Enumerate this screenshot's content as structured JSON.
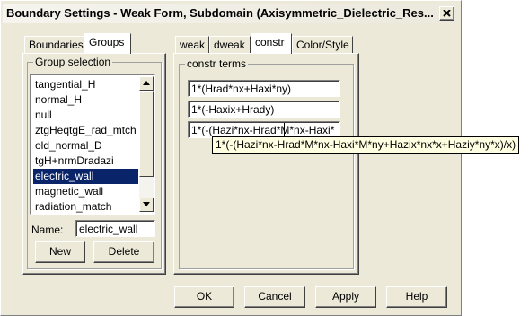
{
  "window": {
    "title": "Boundary Settings - Weak Form, Subdomain (Axisymmetric_Dielectric_Res..."
  },
  "left_tabs": [
    "Boundaries",
    "Groups"
  ],
  "group_selection": {
    "label": "Group selection",
    "items": [
      "tangential_H",
      "normal_H",
      "null",
      "ztgHeqtgE_rad_mtch",
      "old_normal_D",
      "tgH+nrmDradazi",
      "electric_wall",
      "magnetic_wall",
      "radiation_match"
    ],
    "selected": "electric_wall"
  },
  "name_field": {
    "label": "Name:",
    "value": "electric_wall"
  },
  "group_buttons": {
    "new": "New",
    "delete": "Delete"
  },
  "right_tabs": [
    "weak",
    "dweak",
    "constr",
    "Color/Style"
  ],
  "constr_terms": {
    "label": "constr terms",
    "fields": [
      "1*(Hrad*nx+Haxi*ny)",
      "1*(-Haxix+Hrady)",
      "1*(-(Hazi*nx-Hrad*M*nx-Haxi*"
    ]
  },
  "tooltip": "1*(-(Hazi*nx-Hrad*M*nx-Haxi*M*ny+Hazix*nx*x+Haziy*ny*x)/x)",
  "dialog_buttons": {
    "ok": "OK",
    "cancel": "Cancel",
    "apply": "Apply",
    "help": "Help"
  },
  "colors": {
    "dialog_bg": "#ece9d8",
    "selection_bg": "#0a246a",
    "tooltip_bg": "#ffffe1"
  }
}
